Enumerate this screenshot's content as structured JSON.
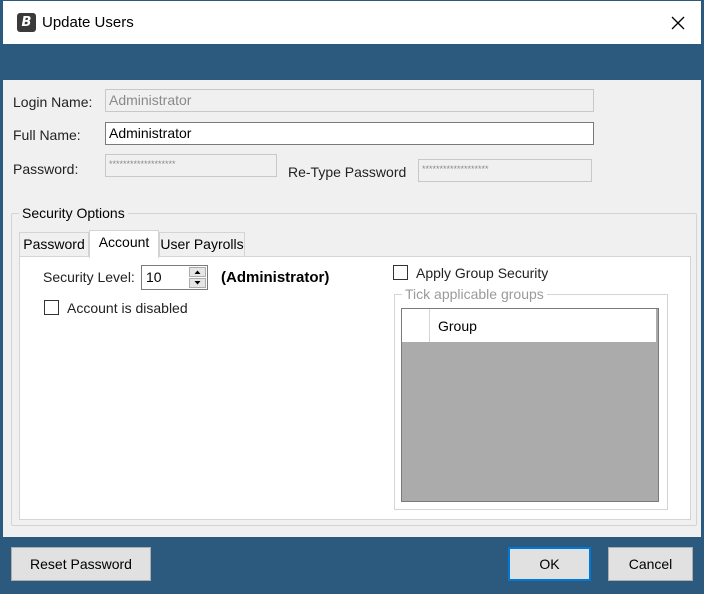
{
  "window": {
    "title": "Update Users"
  },
  "form": {
    "login_name_label": "Login Name:",
    "login_name_value": "Administrator",
    "full_name_label": "Full Name:",
    "full_name_value": "Administrator",
    "password_label": "Password:",
    "password_value": "*******************",
    "retype_label": "Re-Type Password",
    "retype_value": "*******************"
  },
  "security": {
    "legend": "Security Options",
    "tabs": [
      {
        "label": "Password",
        "selected": false
      },
      {
        "label": "Account",
        "selected": true
      },
      {
        "label": "User Payrolls",
        "selected": false
      }
    ],
    "account": {
      "security_level_label": "Security Level:",
      "security_level_value": "10",
      "security_level_name": "(Administrator)",
      "disabled_label": "Account is disabled",
      "disabled_checked": false,
      "apply_group_label": "Apply Group Security",
      "apply_group_checked": false,
      "groups_legend": "Tick applicable groups",
      "groups_column": "Group"
    }
  },
  "footer": {
    "reset_label": "Reset Password",
    "ok_label": "OK",
    "cancel_label": "Cancel"
  },
  "colors": {
    "accent": "#2b5a7e",
    "focus": "#0078d7"
  }
}
